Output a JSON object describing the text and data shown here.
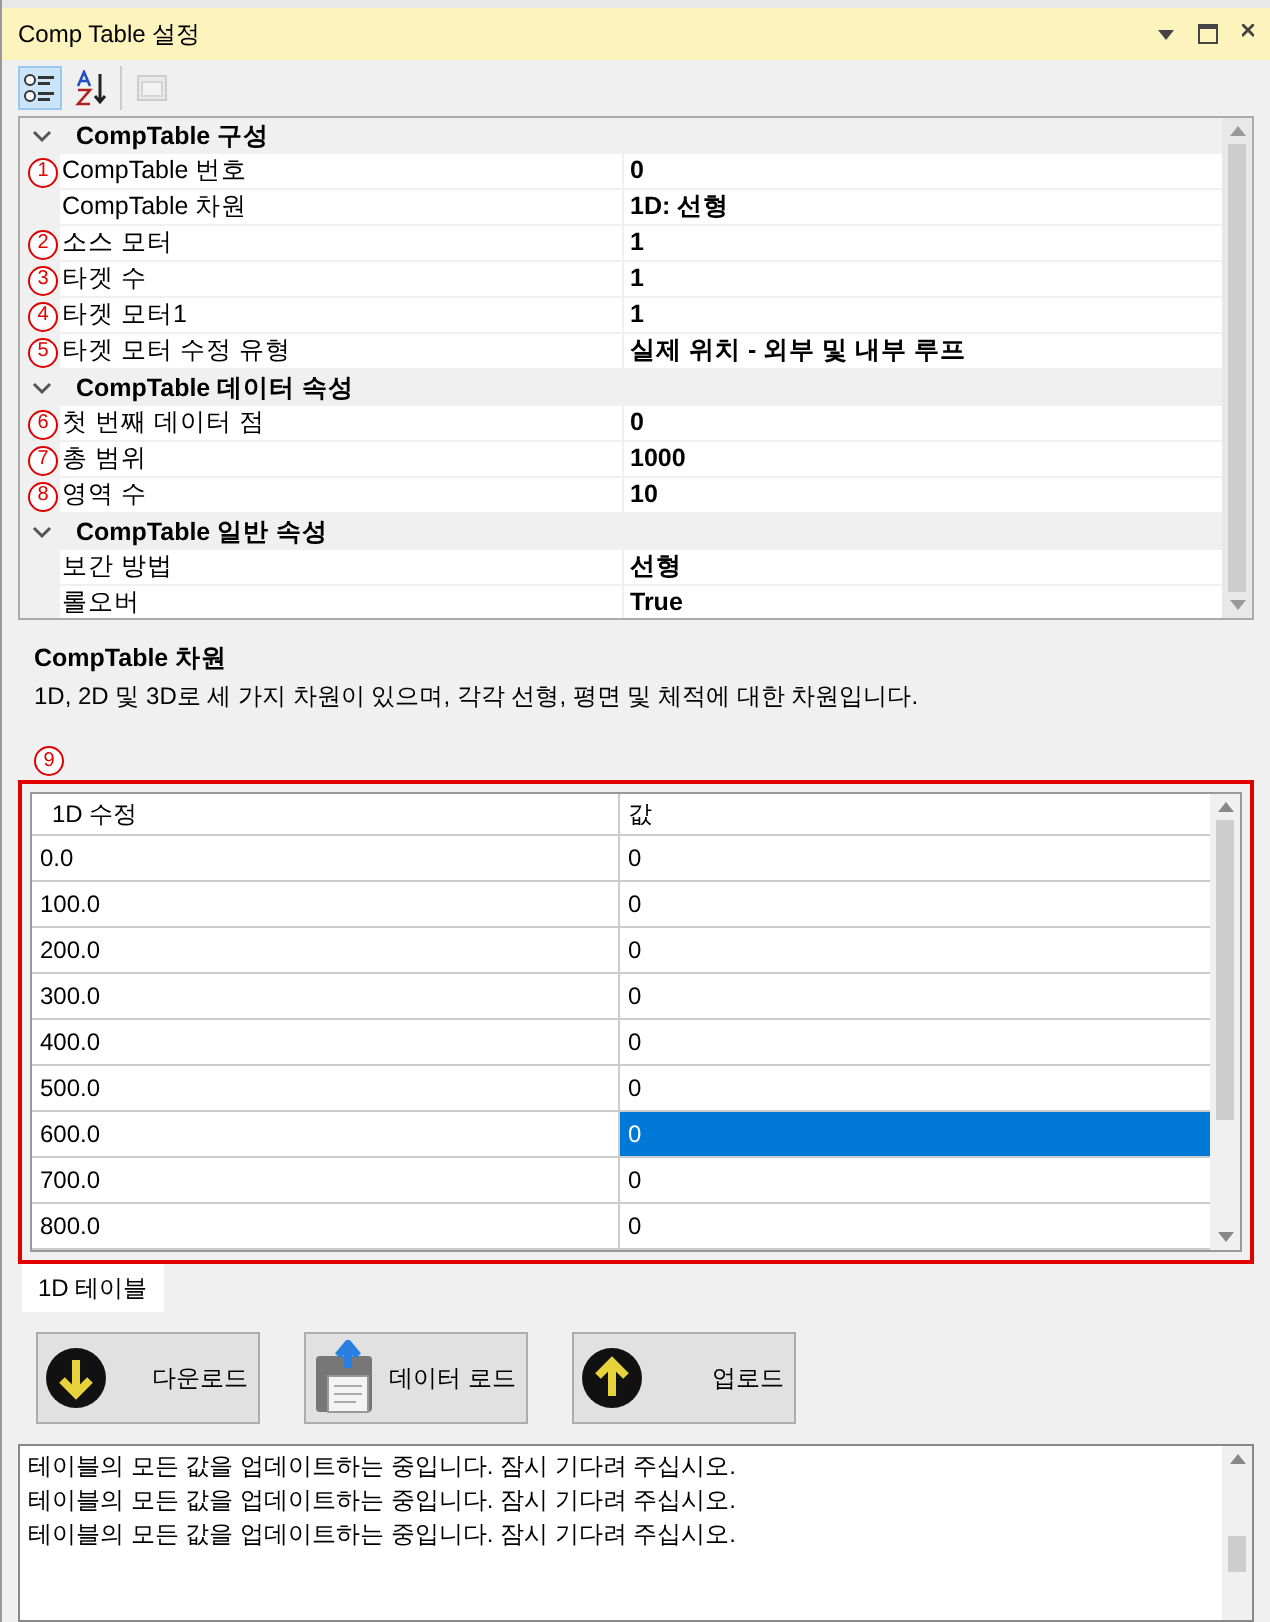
{
  "window": {
    "title": "Comp Table 설정"
  },
  "toolbar": [
    {
      "kind": "categorized",
      "selected": true,
      "disabled": false
    },
    {
      "kind": "alphabetical",
      "selected": false,
      "disabled": false
    },
    {
      "kind": "pages",
      "selected": false,
      "disabled": true
    }
  ],
  "property_grid": {
    "categories": [
      {
        "label": "CompTable 구성",
        "expanded": true,
        "items": [
          {
            "marker": "1",
            "label": "CompTable 번호",
            "value": "0"
          },
          {
            "label": "CompTable 차원",
            "value": "1D: 선형"
          },
          {
            "marker": "2",
            "label": "소스 모터",
            "value": "1"
          },
          {
            "marker": "3",
            "label": "타겟 수",
            "value": "1"
          },
          {
            "marker": "4",
            "label": "타겟 모터1",
            "value": "1"
          },
          {
            "marker": "5",
            "label": "타겟 모터 수정 유형",
            "value": "실제 위치 - 외부 및 내부 루프"
          }
        ]
      },
      {
        "label": "CompTable 데이터 속성",
        "expanded": true,
        "items": [
          {
            "marker": "6",
            "label": "첫 번째 데이터 점",
            "value": "0"
          },
          {
            "marker": "7",
            "label": "총 범위",
            "value": "1000"
          },
          {
            "marker": "8",
            "label": "영역 수",
            "value": "10"
          }
        ]
      },
      {
        "label": "CompTable 일반 속성",
        "expanded": true,
        "items": [
          {
            "label": "보간 방법",
            "value": "선형"
          },
          {
            "label": "롤오버",
            "value": "True"
          }
        ]
      }
    ]
  },
  "description": {
    "title": "CompTable 차원",
    "text": "1D, 2D 및 3D로 세 가지 차원이 있으며, 각각 선형, 평면 및 체적에 대한 차원입니다."
  },
  "table_marker": "9",
  "table": {
    "columns": [
      "1D 수정",
      "값"
    ],
    "rows": [
      {
        "key": "0.0",
        "value": "0",
        "selected": false
      },
      {
        "key": "100.0",
        "value": "0",
        "selected": false
      },
      {
        "key": "200.0",
        "value": "0",
        "selected": false
      },
      {
        "key": "300.0",
        "value": "0",
        "selected": false
      },
      {
        "key": "400.0",
        "value": "0",
        "selected": false
      },
      {
        "key": "500.0",
        "value": "0",
        "selected": false
      },
      {
        "key": "600.0",
        "value": "0",
        "selected": true
      },
      {
        "key": "700.0",
        "value": "0",
        "selected": false
      },
      {
        "key": "800.0",
        "value": "0",
        "selected": false
      }
    ]
  },
  "tabs": [
    {
      "label": "1D 테이블",
      "selected": true
    }
  ],
  "buttons": [
    {
      "kind": "download",
      "label": "다운로드"
    },
    {
      "kind": "load",
      "label": "데이터 로드"
    },
    {
      "kind": "upload",
      "label": "업로드"
    }
  ],
  "log": [
    "테이블의 모든 값을 업데이트하는 중입니다. 잠시 기다려 주십시오.",
    "테이블의 모든 값을 업데이트하는 중입니다. 잠시 기다려 주십시오.",
    "테이블의 모든 값을 업데이트하는 중입니다. 잠시 기다려 주십시오."
  ]
}
